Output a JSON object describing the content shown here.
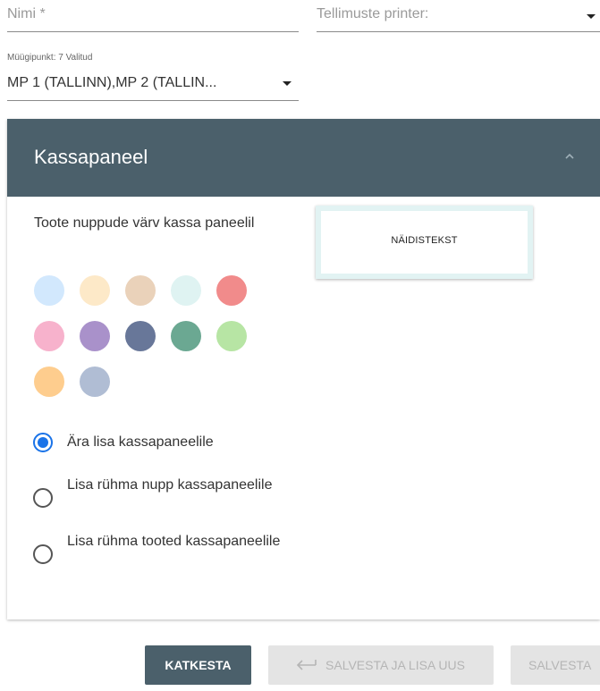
{
  "form": {
    "name_placeholder": "Nimi *",
    "printer_placeholder": "Tellimuste printer:",
    "sales_point": {
      "label": "Müügipunkt: 7 Valitud",
      "value": "MP 1 (TALLINN),MP 2 (TALLIN..."
    }
  },
  "panel": {
    "title": "Kassapaneel",
    "color_label": "Toote nuppude värv kassa paneelil",
    "swatches": [
      "#d2e8fd",
      "#fde9c8",
      "#ead2ba",
      "#dff3f2",
      "#f18b8b",
      "#f7b2cc",
      "#a991ca",
      "#687799",
      "#6ba892",
      "#b7e5a4",
      "#fecd8e",
      "#b0bdd4"
    ],
    "preview_text": "NÄIDISTEKST",
    "radio_options": [
      {
        "label": "Ära lisa kassapaneelile",
        "checked": true
      },
      {
        "label": "Lisa rühma nupp kassapaneelile",
        "checked": false
      },
      {
        "label": "Lisa rühma tooted kassapaneelile",
        "checked": false
      }
    ]
  },
  "buttons": {
    "cancel": "KATKESTA",
    "save_and_new": "SALVESTA JA LISA UUS",
    "save": "SALVESTA"
  },
  "colors": {
    "header_bg": "#4b606b",
    "radio_accent": "#1a73e8"
  }
}
